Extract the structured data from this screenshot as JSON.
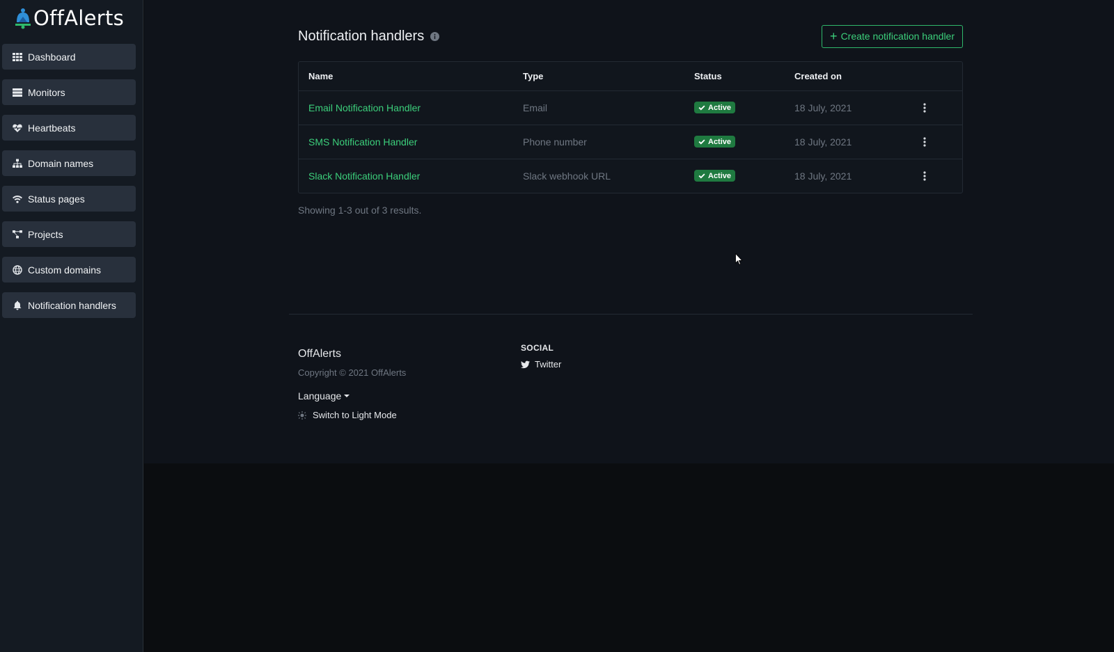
{
  "brand": {
    "name": "OffAlerts",
    "accent": "#3ccf7b"
  },
  "sidebar": {
    "items": [
      {
        "label": "Dashboard",
        "icon": "grid-icon"
      },
      {
        "label": "Monitors",
        "icon": "server-icon"
      },
      {
        "label": "Heartbeats",
        "icon": "heartbeat-icon"
      },
      {
        "label": "Domain names",
        "icon": "network-icon"
      },
      {
        "label": "Status pages",
        "icon": "wifi-icon"
      },
      {
        "label": "Projects",
        "icon": "project-diagram-icon"
      },
      {
        "label": "Custom domains",
        "icon": "globe-icon"
      },
      {
        "label": "Notification handlers",
        "icon": "bell-icon"
      }
    ]
  },
  "main": {
    "title": "Notification handlers",
    "create_button": "Create notification handler",
    "table": {
      "headers": {
        "name": "Name",
        "type": "Type",
        "status": "Status",
        "created": "Created on"
      },
      "rows": [
        {
          "name": "Email Notification Handler",
          "type": "Email",
          "status": "Active",
          "created": "18 July, 2021"
        },
        {
          "name": "SMS Notification Handler",
          "type": "Phone number",
          "status": "Active",
          "created": "18 July, 2021"
        },
        {
          "name": "Slack Notification Handler",
          "type": "Slack webhook URL",
          "status": "Active",
          "created": "18 July, 2021"
        }
      ]
    },
    "results_text": "Showing 1-3 out of 3 results."
  },
  "footer": {
    "brand": "OffAlerts",
    "copyright": "Copyright © 2021 OffAlerts",
    "language_label": "Language",
    "theme_toggle": "Switch to Light Mode",
    "social_heading": "SOCIAL",
    "twitter_label": "Twitter"
  }
}
